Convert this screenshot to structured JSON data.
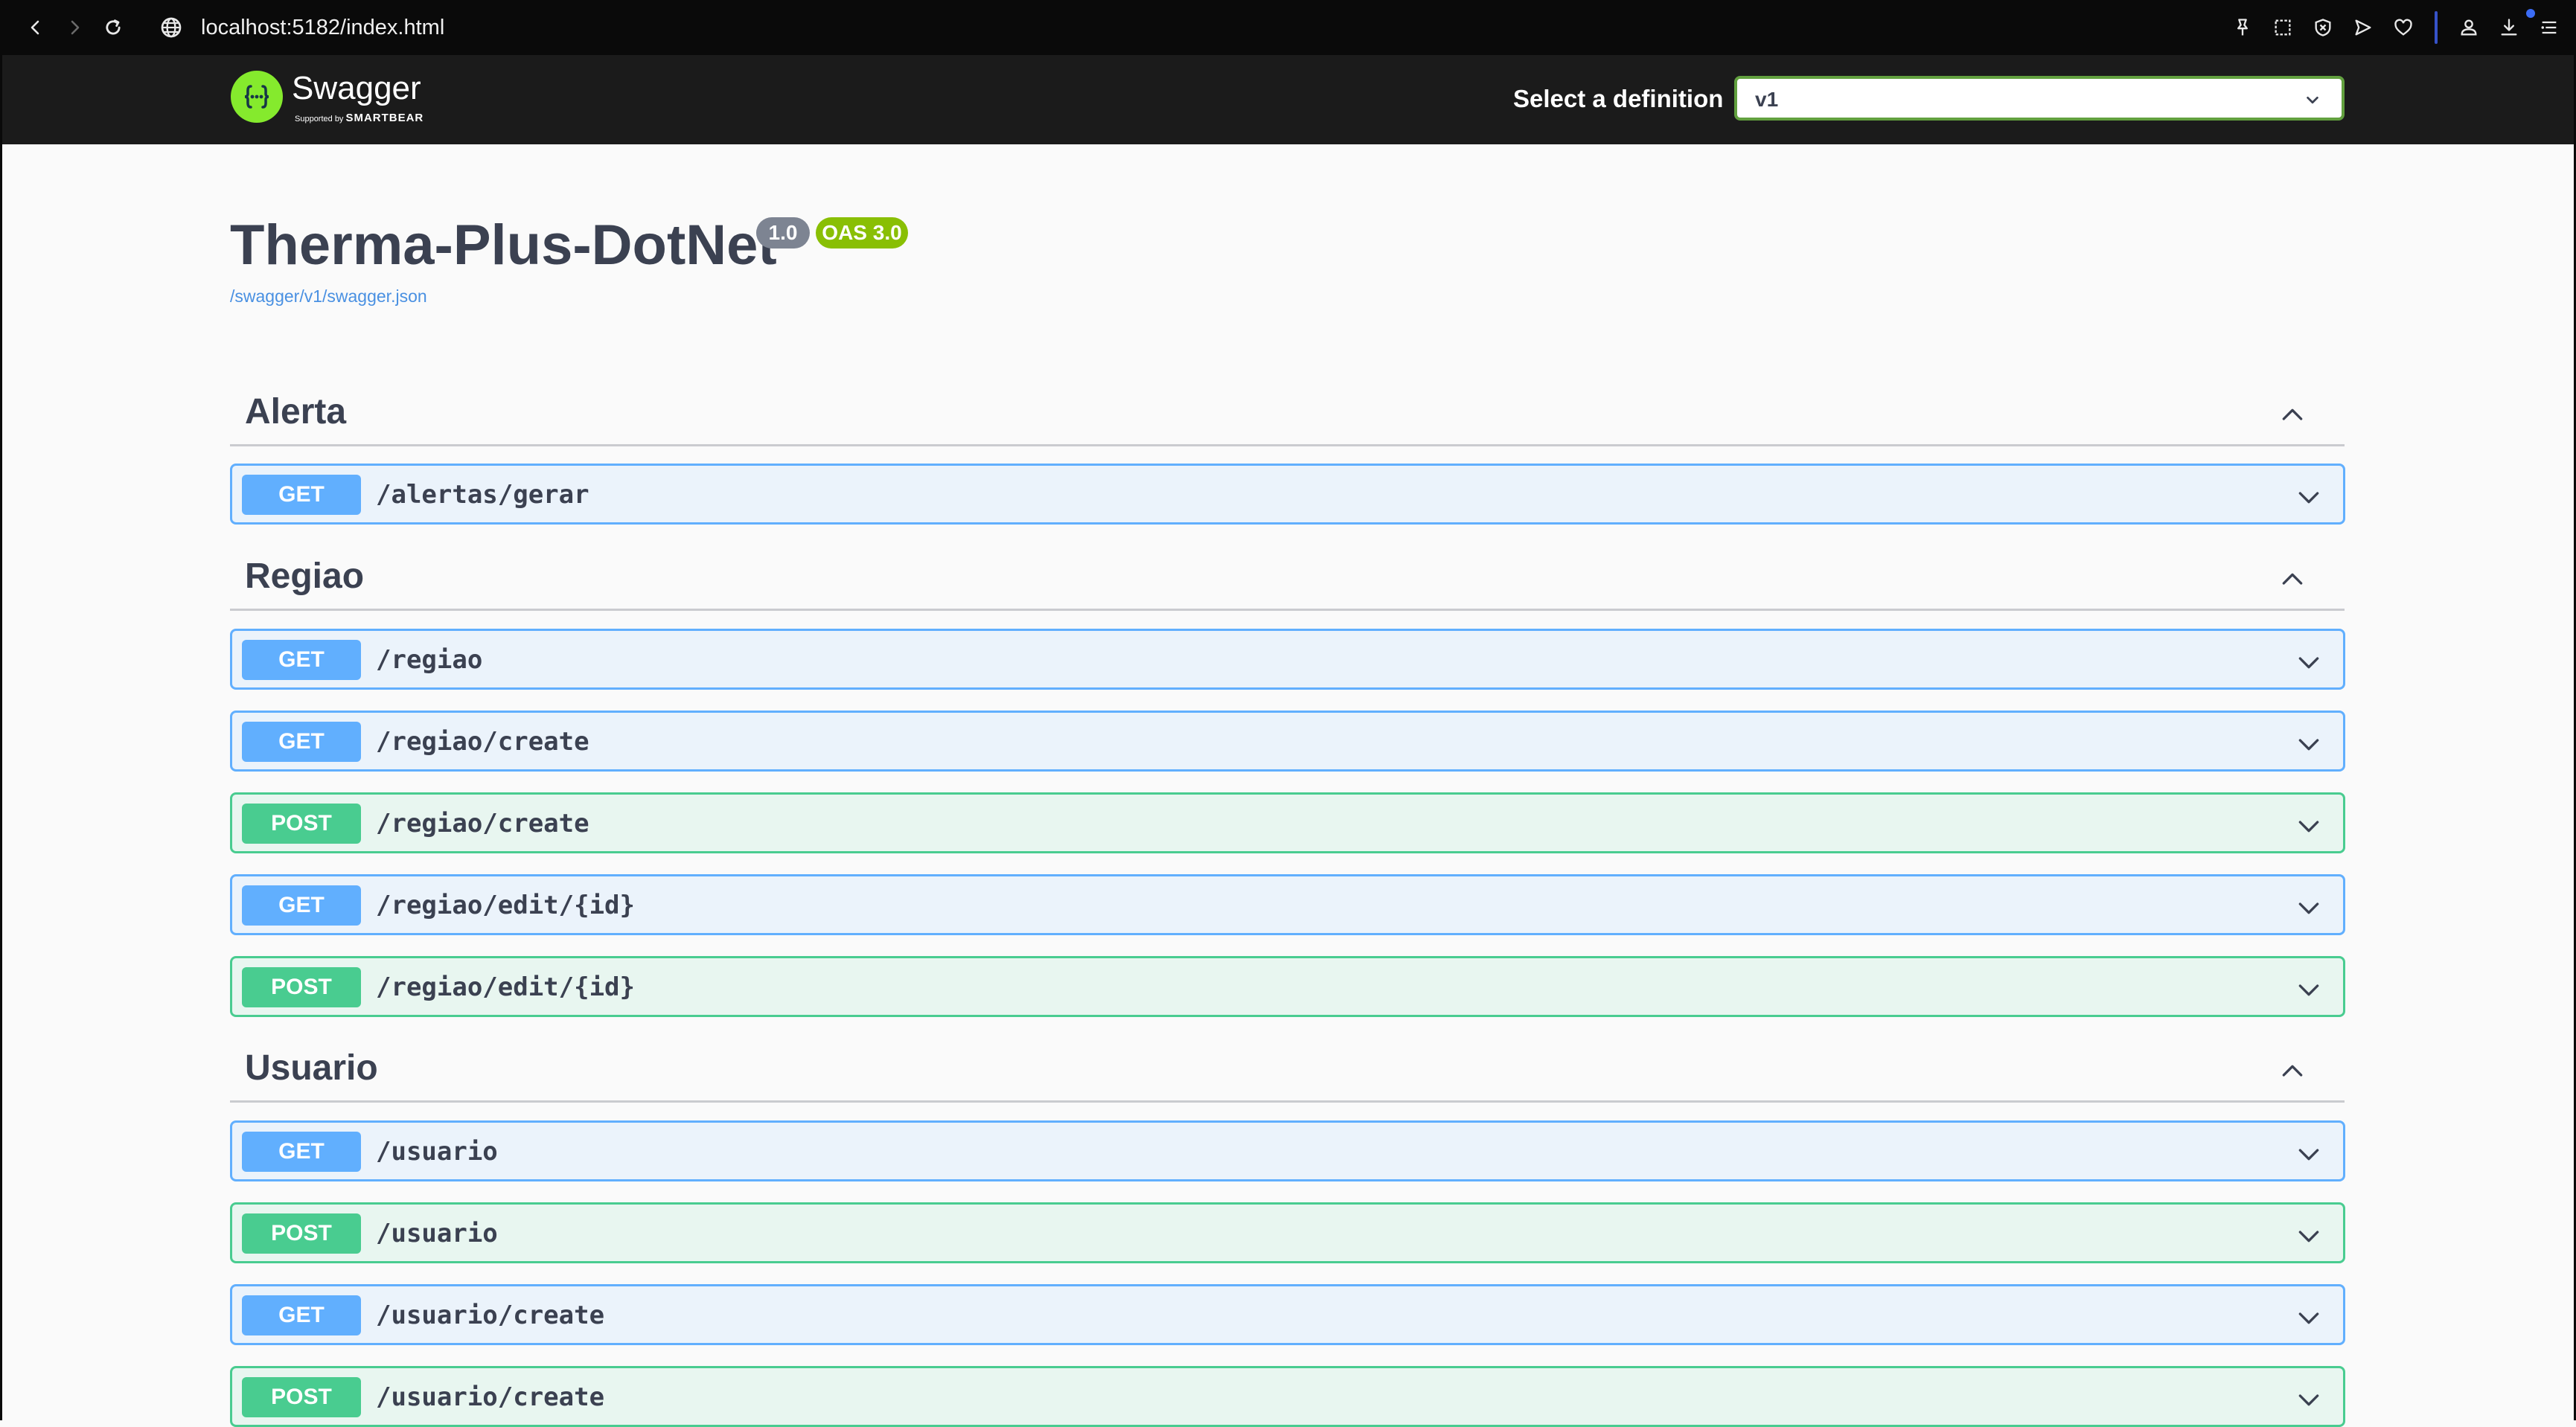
{
  "browser": {
    "url": "localhost:5182/index.html",
    "icons": [
      "back-icon",
      "forward-icon",
      "reload-icon",
      "globe-icon",
      "pin-icon",
      "screenshot-icon",
      "block-icon",
      "send-icon",
      "heart-icon",
      "profile-icon",
      "download-icon",
      "menu-icon"
    ]
  },
  "topbar": {
    "brand": "Swagger",
    "support_prefix": "Supported by",
    "support_brand": "SMARTBEAR",
    "definition_label": "Select a definition",
    "definition_value": "v1",
    "accent": "#85ea2d"
  },
  "info": {
    "title": "Therma-Plus-DotNet",
    "version": "1.0",
    "oas": "OAS 3.0",
    "spec_url": "/swagger/v1/swagger.json"
  },
  "colors": {
    "get": "#61affe",
    "post": "#49cc90",
    "get_bg": "#ebf3fb",
    "post_bg": "#e8f6f0"
  },
  "tags": [
    {
      "name": "Alerta",
      "ops": [
        {
          "method": "GET",
          "path": "/alertas/gerar"
        }
      ]
    },
    {
      "name": "Regiao",
      "ops": [
        {
          "method": "GET",
          "path": "/regiao"
        },
        {
          "method": "GET",
          "path": "/regiao/create"
        },
        {
          "method": "POST",
          "path": "/regiao/create"
        },
        {
          "method": "GET",
          "path": "/regiao/edit/{id}"
        },
        {
          "method": "POST",
          "path": "/regiao/edit/{id}"
        }
      ]
    },
    {
      "name": "Usuario",
      "ops": [
        {
          "method": "GET",
          "path": "/usuario"
        },
        {
          "method": "POST",
          "path": "/usuario"
        },
        {
          "method": "GET",
          "path": "/usuario/create"
        },
        {
          "method": "POST",
          "path": "/usuario/create"
        }
      ]
    }
  ]
}
